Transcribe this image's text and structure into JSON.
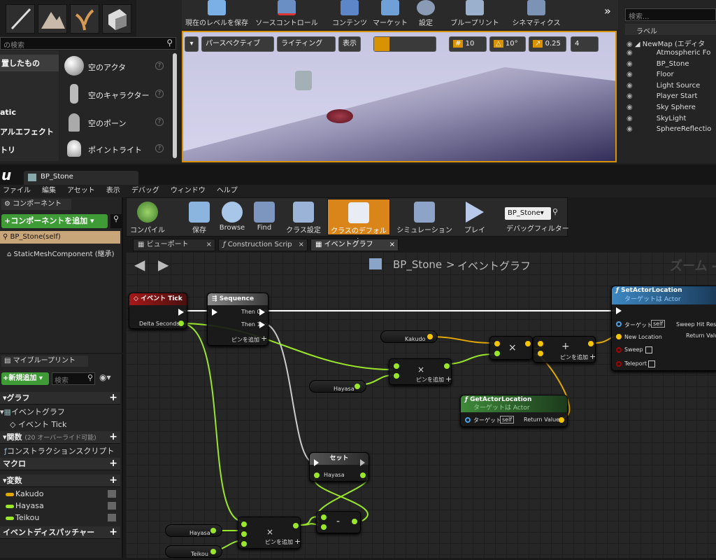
{
  "top": {
    "search_placeholder": "の検索",
    "placed_label": "置したもの",
    "categories": [
      "atic",
      "アルエフェクト",
      "トリ"
    ],
    "actors": [
      {
        "label": "空のアクタ"
      },
      {
        "label": "空のキャラクター"
      },
      {
        "label": "空のポーン"
      },
      {
        "label": "ポイントライト"
      }
    ],
    "toolbar": [
      {
        "label": "現在のレベルを保存"
      },
      {
        "label": "ソースコントロール"
      },
      {
        "label": "コンテンツ"
      },
      {
        "label": "マーケット"
      },
      {
        "label": "設定"
      },
      {
        "label": "ブループリント"
      },
      {
        "label": "シネマティクス"
      }
    ],
    "viewport": {
      "perspective": "パースペクティブ",
      "lighting": "ライティング",
      "show": "表示",
      "grid": "10",
      "rot": "10°",
      "scale": "0.25",
      "cam": "4"
    },
    "outliner": {
      "search_placeholder": "検索...",
      "col_label": "ラベル",
      "root": "NewMap (エディタ",
      "items": [
        "Atmospheric Fo",
        "BP_Stone",
        "Floor",
        "Light Source",
        "Player Start",
        "Sky Sphere",
        "SkyLight",
        "SphereReflectio"
      ]
    }
  },
  "bp": {
    "tab_title": "BP_Stone",
    "menu": [
      "ファイル",
      "編集",
      "アセット",
      "表示",
      "デバッグ",
      "ウィンドウ",
      "ヘルプ"
    ],
    "components": {
      "header": "コンポーネント",
      "add_button": "+コンポーネントを追加 ▾",
      "self": "BP_Stone(self)",
      "mesh": "StaticMeshComponent (継承)"
    },
    "toolbar": [
      {
        "label": "コンパイル"
      },
      {
        "label": "保存"
      },
      {
        "label": "Browse"
      },
      {
        "label": "Find"
      },
      {
        "label": "クラス設定"
      },
      {
        "label": "クラスのデフォルト"
      },
      {
        "label": "シミュレーション"
      },
      {
        "label": "プレイ"
      }
    ],
    "debug": {
      "value": "BP_Stone▾",
      "label": "デバッグフィルター"
    },
    "tabs": [
      "ビューポート",
      "Construction Scrip",
      "イベントグラフ"
    ],
    "breadcrumb": {
      "bp": "BP_Stone",
      "sep": ">",
      "graph": "イベントグラフ",
      "zoom": "ズーム -"
    },
    "mybp": {
      "header": "マイブループリント",
      "new_button": "+新規追加 ▾",
      "search_placeholder": "検索",
      "graph": "グラフ",
      "eventgraph": "イベントグラフ",
      "eventtick": "イベント Tick",
      "functions": "関数",
      "functions_note": "(20 オーバーライド可能)",
      "construction": "コンストラクションスクリプト",
      "macro": "マクロ",
      "variables": "変数",
      "vars": [
        {
          "name": "Kakudo",
          "color": "#e0a800"
        },
        {
          "name": "Hayasa",
          "color": "#9ae62b"
        },
        {
          "name": "Teikou",
          "color": "#9ae62b"
        }
      ],
      "dispatcher": "イベントディスパッチャー"
    },
    "nodes": {
      "tick": {
        "title": "イベント Tick",
        "delta": "Delta Seconds"
      },
      "seq": {
        "title": "Sequence",
        "then0": "Then 0",
        "then1": "Then 1",
        "add": "ピンを追加"
      },
      "set_loc": {
        "title": "SetActorLocation",
        "sub": "ターゲットは Actor",
        "target": "ターゲット",
        "self": "self",
        "newloc": "New Location",
        "sweep": "Sweep",
        "teleport": "Teleport",
        "hit": "Sweep Hit Result",
        "ret": "Return Value"
      },
      "get_loc": {
        "title": "GetActorLocation",
        "sub": "ターゲットは Actor",
        "target": "ターゲット",
        "self": "self",
        "ret": "Return Value"
      },
      "kakudo": "Kakudo",
      "hayasa": "Hayasa",
      "hayasa2": "Hayasa",
      "teikou": "Teikou",
      "mul": "×",
      "add_op": "+",
      "sub_op": "-",
      "add_pin": "ピンを追加",
      "set": {
        "title": "セット",
        "var": "Hayasa"
      }
    }
  }
}
